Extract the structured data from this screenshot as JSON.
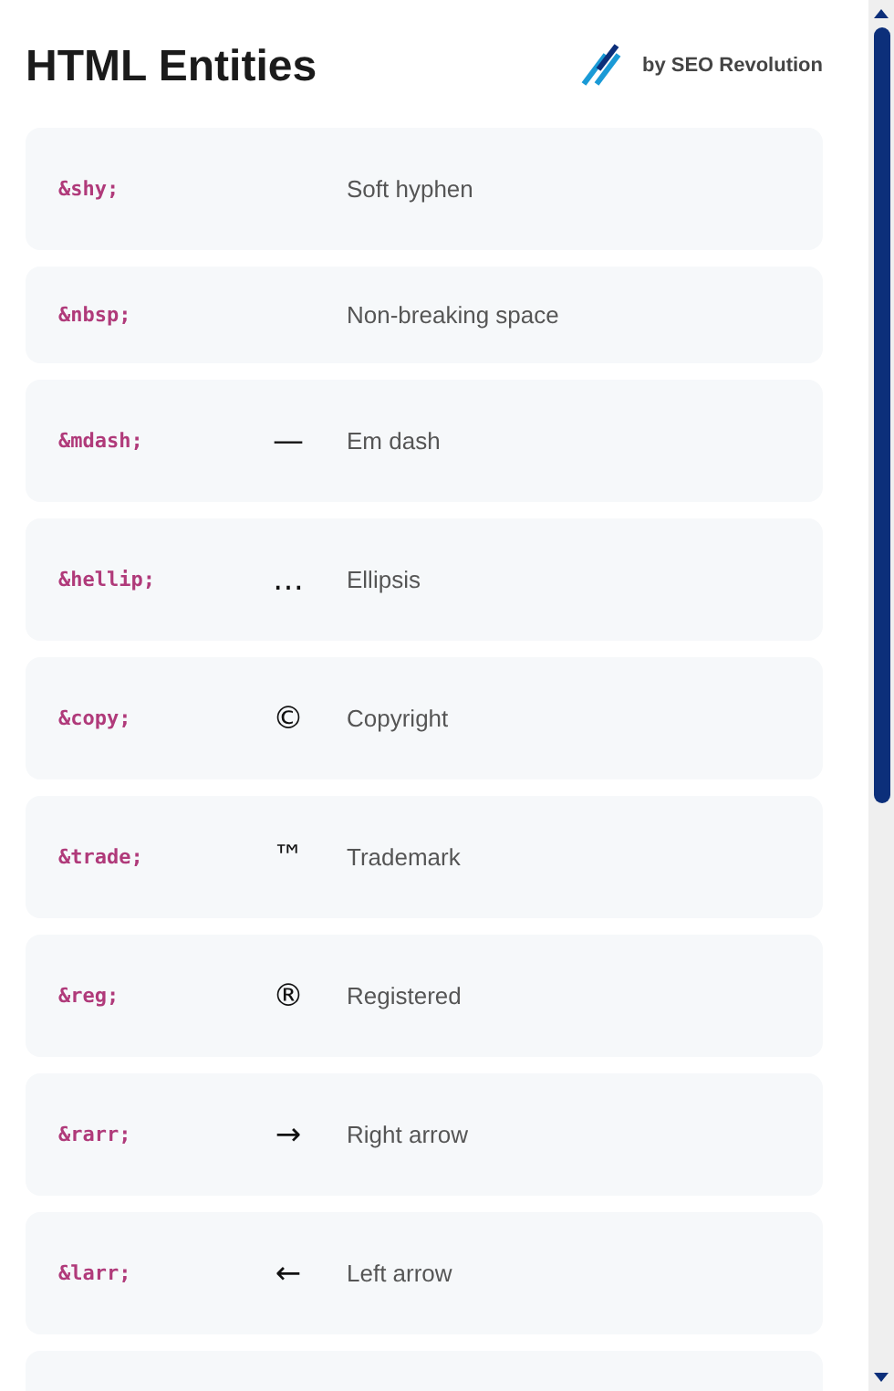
{
  "header": {
    "title": "HTML Entities",
    "credit": "by SEO Revolution"
  },
  "entities": [
    {
      "kind": "entry",
      "code": "&shy;",
      "name": "Soft hyphen"
    },
    {
      "kind": "entry",
      "code": "&nbsp;",
      "name": "Non-breaking space"
    },
    {
      "kind": "entry",
      "code": "&mdash;",
      "symbol": "—",
      "name": "Em dash"
    },
    {
      "kind": "entry",
      "code": "&hellip;",
      "symbol": "…",
      "name": "Ellipsis"
    },
    {
      "kind": "entry",
      "code": "&copy;",
      "symbol": "©",
      "name": "Copyright"
    },
    {
      "kind": "entry",
      "code": "&trade;",
      "symbol": "™",
      "name": "Trademark"
    },
    {
      "kind": "entry",
      "code": "&reg;",
      "symbol": "®",
      "name": "Registered"
    },
    {
      "kind": "entry",
      "code": "&rarr;",
      "symbol": "→",
      "name": "Right arrow"
    },
    {
      "kind": "entry",
      "code": "&larr;",
      "symbol": "←",
      "name": "Left arrow"
    },
    {
      "kind": "partial"
    }
  ]
}
